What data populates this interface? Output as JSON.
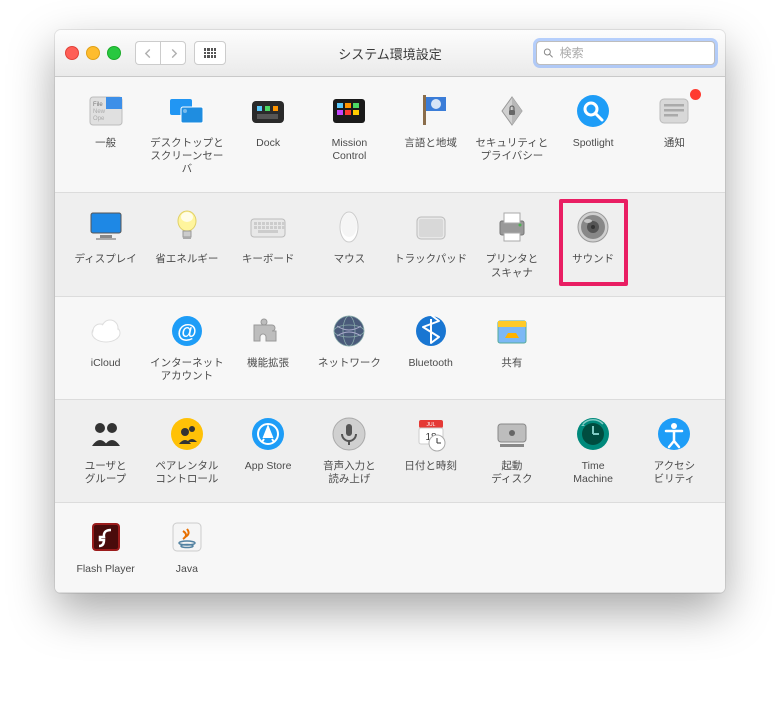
{
  "window": {
    "title": "システム環境設定",
    "search_placeholder": "検索"
  },
  "rows": [
    {
      "alt": false,
      "items": [
        {
          "id": "general",
          "label": "一般"
        },
        {
          "id": "desktop",
          "label": "デスクトップと\nスクリーンセーバ"
        },
        {
          "id": "dock",
          "label": "Dock"
        },
        {
          "id": "mission",
          "label": "Mission\nControl"
        },
        {
          "id": "language",
          "label": "言語と地域"
        },
        {
          "id": "security",
          "label": "セキュリティと\nプライバシー"
        },
        {
          "id": "spotlight",
          "label": "Spotlight"
        },
        {
          "id": "notifications",
          "label": "通知",
          "badge": true
        }
      ]
    },
    {
      "alt": true,
      "items": [
        {
          "id": "displays",
          "label": "ディスプレイ"
        },
        {
          "id": "energy",
          "label": "省エネルギー"
        },
        {
          "id": "keyboard",
          "label": "キーボード"
        },
        {
          "id": "mouse",
          "label": "マウス"
        },
        {
          "id": "trackpad",
          "label": "トラックパッド"
        },
        {
          "id": "printers",
          "label": "プリンタと\nスキャナ"
        },
        {
          "id": "sound",
          "label": "サウンド",
          "highlight": true
        }
      ]
    },
    {
      "alt": false,
      "items": [
        {
          "id": "icloud",
          "label": "iCloud"
        },
        {
          "id": "internet",
          "label": "インターネット\nアカウント"
        },
        {
          "id": "extensions",
          "label": "機能拡張"
        },
        {
          "id": "network",
          "label": "ネットワーク"
        },
        {
          "id": "bluetooth",
          "label": "Bluetooth"
        },
        {
          "id": "sharing",
          "label": "共有"
        }
      ]
    },
    {
      "alt": true,
      "items": [
        {
          "id": "users",
          "label": "ユーザと\nグループ"
        },
        {
          "id": "parental",
          "label": "ペアレンタル\nコントロール"
        },
        {
          "id": "appstore",
          "label": "App Store"
        },
        {
          "id": "dictation",
          "label": "音声入力と\n読み上げ"
        },
        {
          "id": "datetime",
          "label": "日付と時刻"
        },
        {
          "id": "startup",
          "label": "起動\nディスク"
        },
        {
          "id": "timemachine",
          "label": "Time\nMachine"
        },
        {
          "id": "accessibility",
          "label": "アクセシ\nビリティ"
        }
      ]
    },
    {
      "alt": false,
      "items": [
        {
          "id": "flash",
          "label": "Flash Player"
        },
        {
          "id": "java",
          "label": "Java"
        }
      ]
    }
  ]
}
